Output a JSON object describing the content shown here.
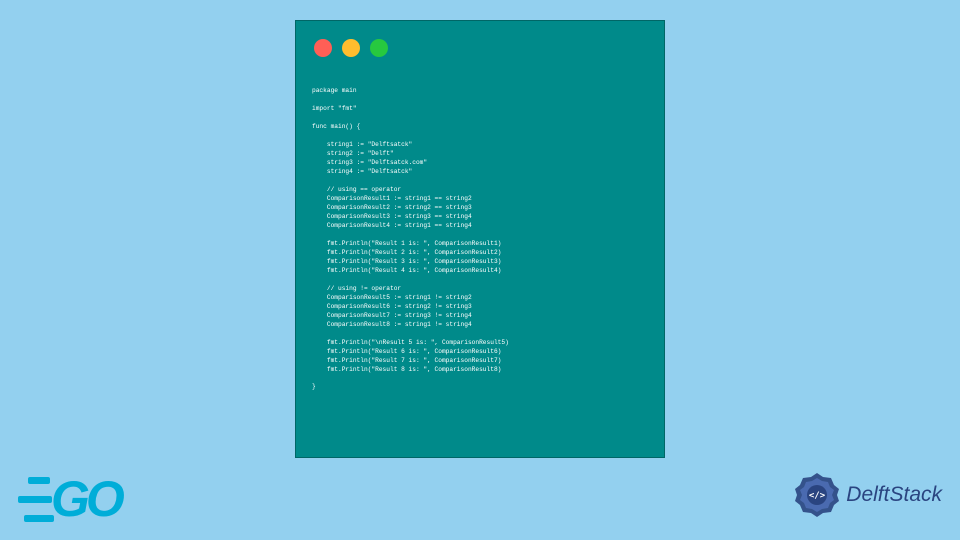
{
  "colors": {
    "background": "#93d0ef",
    "window": "#008a8a",
    "goBlue": "#00add8",
    "delftNavy": "#2a4480"
  },
  "windowControls": {
    "red": "#ff5f56",
    "yellow": "#ffbd2e",
    "green": "#27c93f"
  },
  "code": {
    "content": "package main\n\nimport \"fmt\"\n\nfunc main() {\n\n    string1 := \"Delftsatck\"\n    string2 := \"Delft\"\n    string3 := \"Delftsatck.com\"\n    string4 := \"Delftsatck\"\n\n    // using == operator\n    ComparisonResult1 := string1 == string2\n    ComparisonResult2 := string2 == string3\n    ComparisonResult3 := string3 == string4\n    ComparisonResult4 := string1 == string4\n\n    fmt.Println(\"Result 1 is: \", ComparisonResult1)\n    fmt.Println(\"Result 2 is: \", ComparisonResult2)\n    fmt.Println(\"Result 3 is: \", ComparisonResult3)\n    fmt.Println(\"Result 4 is: \", ComparisonResult4)\n\n    // using != operator\n    ComparisonResult5 := string1 != string2\n    ComparisonResult6 := string2 != string3\n    ComparisonResult7 := string3 != string4\n    ComparisonResult8 := string1 != string4\n\n    fmt.Println(\"\\nResult 5 is: \", ComparisonResult5)\n    fmt.Println(\"Result 6 is: \", ComparisonResult6)\n    fmt.Println(\"Result 7 is: \", ComparisonResult7)\n    fmt.Println(\"Result 8 is: \", ComparisonResult8)\n\n}"
  },
  "brands": {
    "goLogoText": "GO",
    "delftStackText": "DelftStack",
    "delftIconText": "</>"
  }
}
